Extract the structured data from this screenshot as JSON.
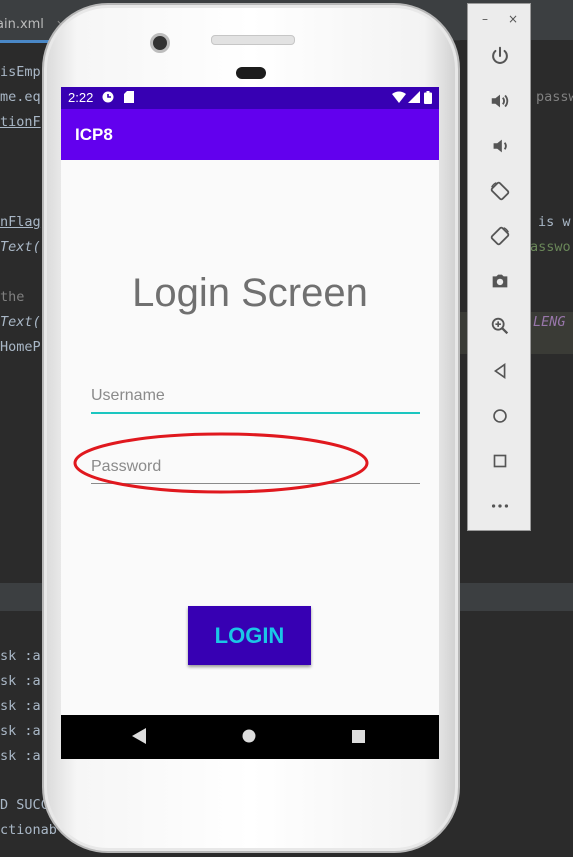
{
  "ide": {
    "file_tab": "ain.xml",
    "code_lines": [
      "isEmp",
      "me.eq",
      "tionF",
      "",
      "",
      "nFlag",
      "Text(",
      "",
      " the",
      "Text(",
      "HomeP"
    ],
    "right_code": [
      "passw",
      "is w",
      "asswo",
      "LENG"
    ],
    "console_lines": [
      "sk :a",
      "sk :a",
      "sk :a",
      "sk :a",
      "sk :a",
      "",
      "D SUCC",
      "ctionab"
    ]
  },
  "emulator_panel": {
    "minimize": "–",
    "close": "×",
    "buttons": [
      {
        "name": "power-icon"
      },
      {
        "name": "volume-up-icon"
      },
      {
        "name": "volume-down-icon"
      },
      {
        "name": "rotate-left-icon"
      },
      {
        "name": "rotate-right-icon"
      },
      {
        "name": "camera-icon"
      },
      {
        "name": "zoom-icon"
      },
      {
        "name": "back-icon"
      },
      {
        "name": "home-icon"
      },
      {
        "name": "overview-icon"
      },
      {
        "name": "more-icon"
      }
    ]
  },
  "statusbar": {
    "time": "2:22"
  },
  "appbar": {
    "title": "ICP8"
  },
  "login": {
    "heading": "Login Screen",
    "username_placeholder": "Username",
    "password_placeholder": "Password",
    "button_label": "LOGIN"
  },
  "colors": {
    "status_bar": "#3700b3",
    "app_bar": "#6200ee",
    "accent": "#1bc6c0",
    "button": "#3700b3",
    "annotation": "#e0181e"
  }
}
